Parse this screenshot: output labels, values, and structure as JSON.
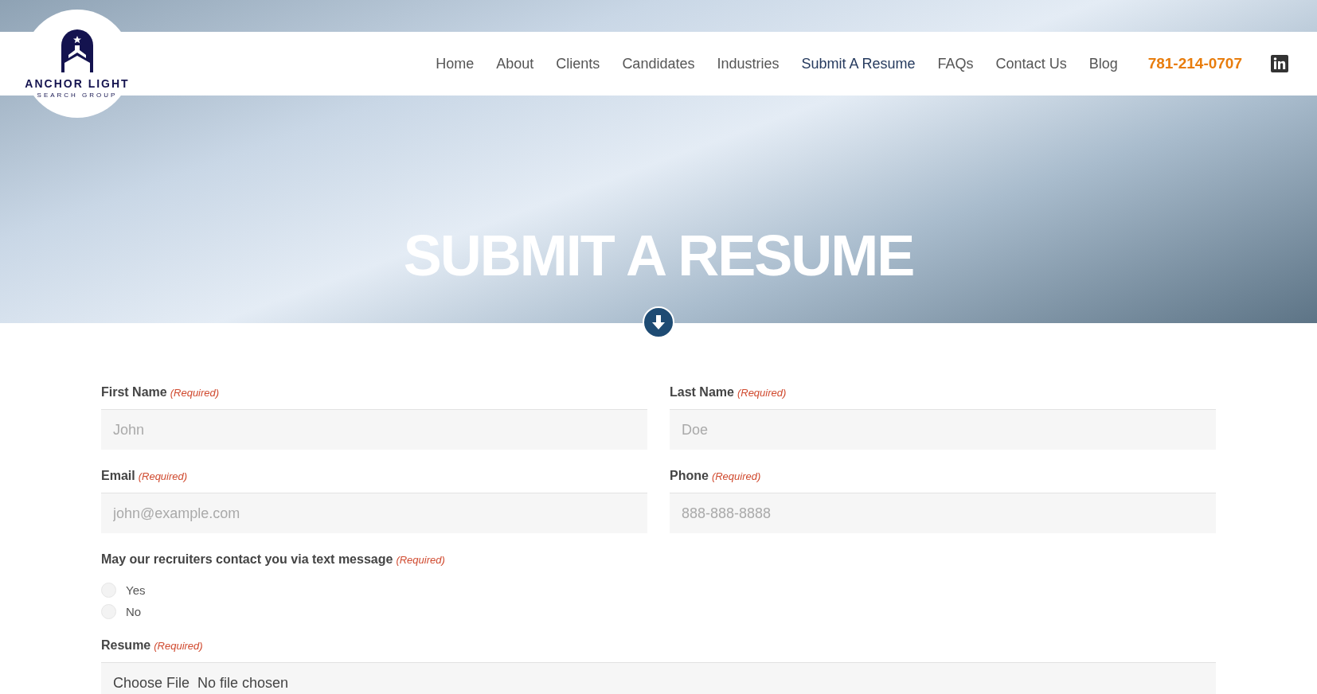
{
  "logo": {
    "name": "ANCHOR LIGHT",
    "tagline": "SEARCH GROUP"
  },
  "nav": [
    {
      "label": "Home",
      "selected": false
    },
    {
      "label": "About",
      "selected": false
    },
    {
      "label": "Clients",
      "selected": false
    },
    {
      "label": "Candidates",
      "selected": false
    },
    {
      "label": "Industries",
      "selected": false
    },
    {
      "label": "Submit A Resume",
      "selected": true
    },
    {
      "label": "FAQs",
      "selected": false
    },
    {
      "label": "Contact Us",
      "selected": false
    },
    {
      "label": "Blog",
      "selected": false
    }
  ],
  "phone": "781-214-0707",
  "hero": {
    "title": "SUBMIT A RESUME"
  },
  "form": {
    "fields": [
      {
        "kind": "text",
        "label": "First Name",
        "required": "(Required)",
        "placeholder": "John"
      },
      {
        "kind": "text",
        "label": "Last Name",
        "required": "(Required)",
        "placeholder": "Doe"
      },
      {
        "kind": "text",
        "label": "Email",
        "required": "(Required)",
        "placeholder": "john@example.com"
      },
      {
        "kind": "text",
        "label": "Phone",
        "required": "(Required)",
        "placeholder": "888-888-8888"
      },
      {
        "kind": "radio",
        "label": "May our recruiters contact you via text message",
        "required": "(Required)",
        "options": [
          {
            "label": "Yes",
            "selected": false
          },
          {
            "label": "No",
            "selected": false
          }
        ]
      },
      {
        "kind": "file",
        "label": "Resume",
        "required": "(Required)",
        "button": "Choose File",
        "status": "No file chosen"
      }
    ]
  }
}
